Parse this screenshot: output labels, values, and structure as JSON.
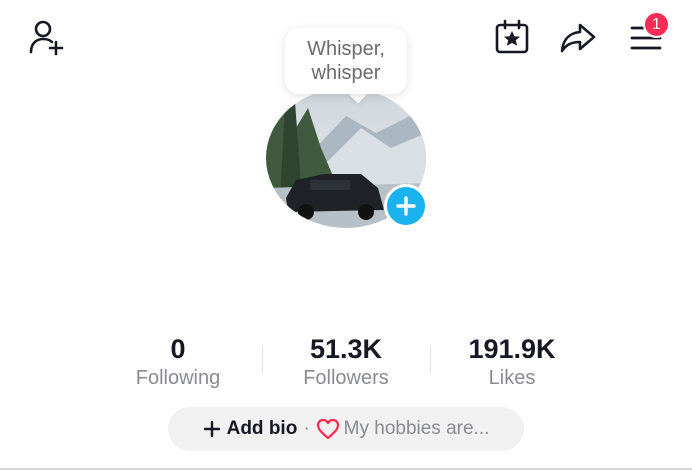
{
  "header": {
    "icons": [
      "add-friend-icon",
      "calendar-star-icon",
      "share-icon",
      "menu-icon"
    ],
    "notification_count": "1"
  },
  "profile": {
    "note_bubble": "Whisper, whisper"
  },
  "stats": [
    {
      "value": "0",
      "label": "Following"
    },
    {
      "value": "51.3K",
      "label": "Followers"
    },
    {
      "value": "191.9K",
      "label": "Likes"
    }
  ],
  "bio": {
    "add_label": "Add bio",
    "separator": "·",
    "hobbies_label": "My hobbies are..."
  },
  "colors": {
    "accent_red": "#fe2c55",
    "avatar_plus": "#1ab3ef",
    "muted_text": "#8a8b91"
  }
}
